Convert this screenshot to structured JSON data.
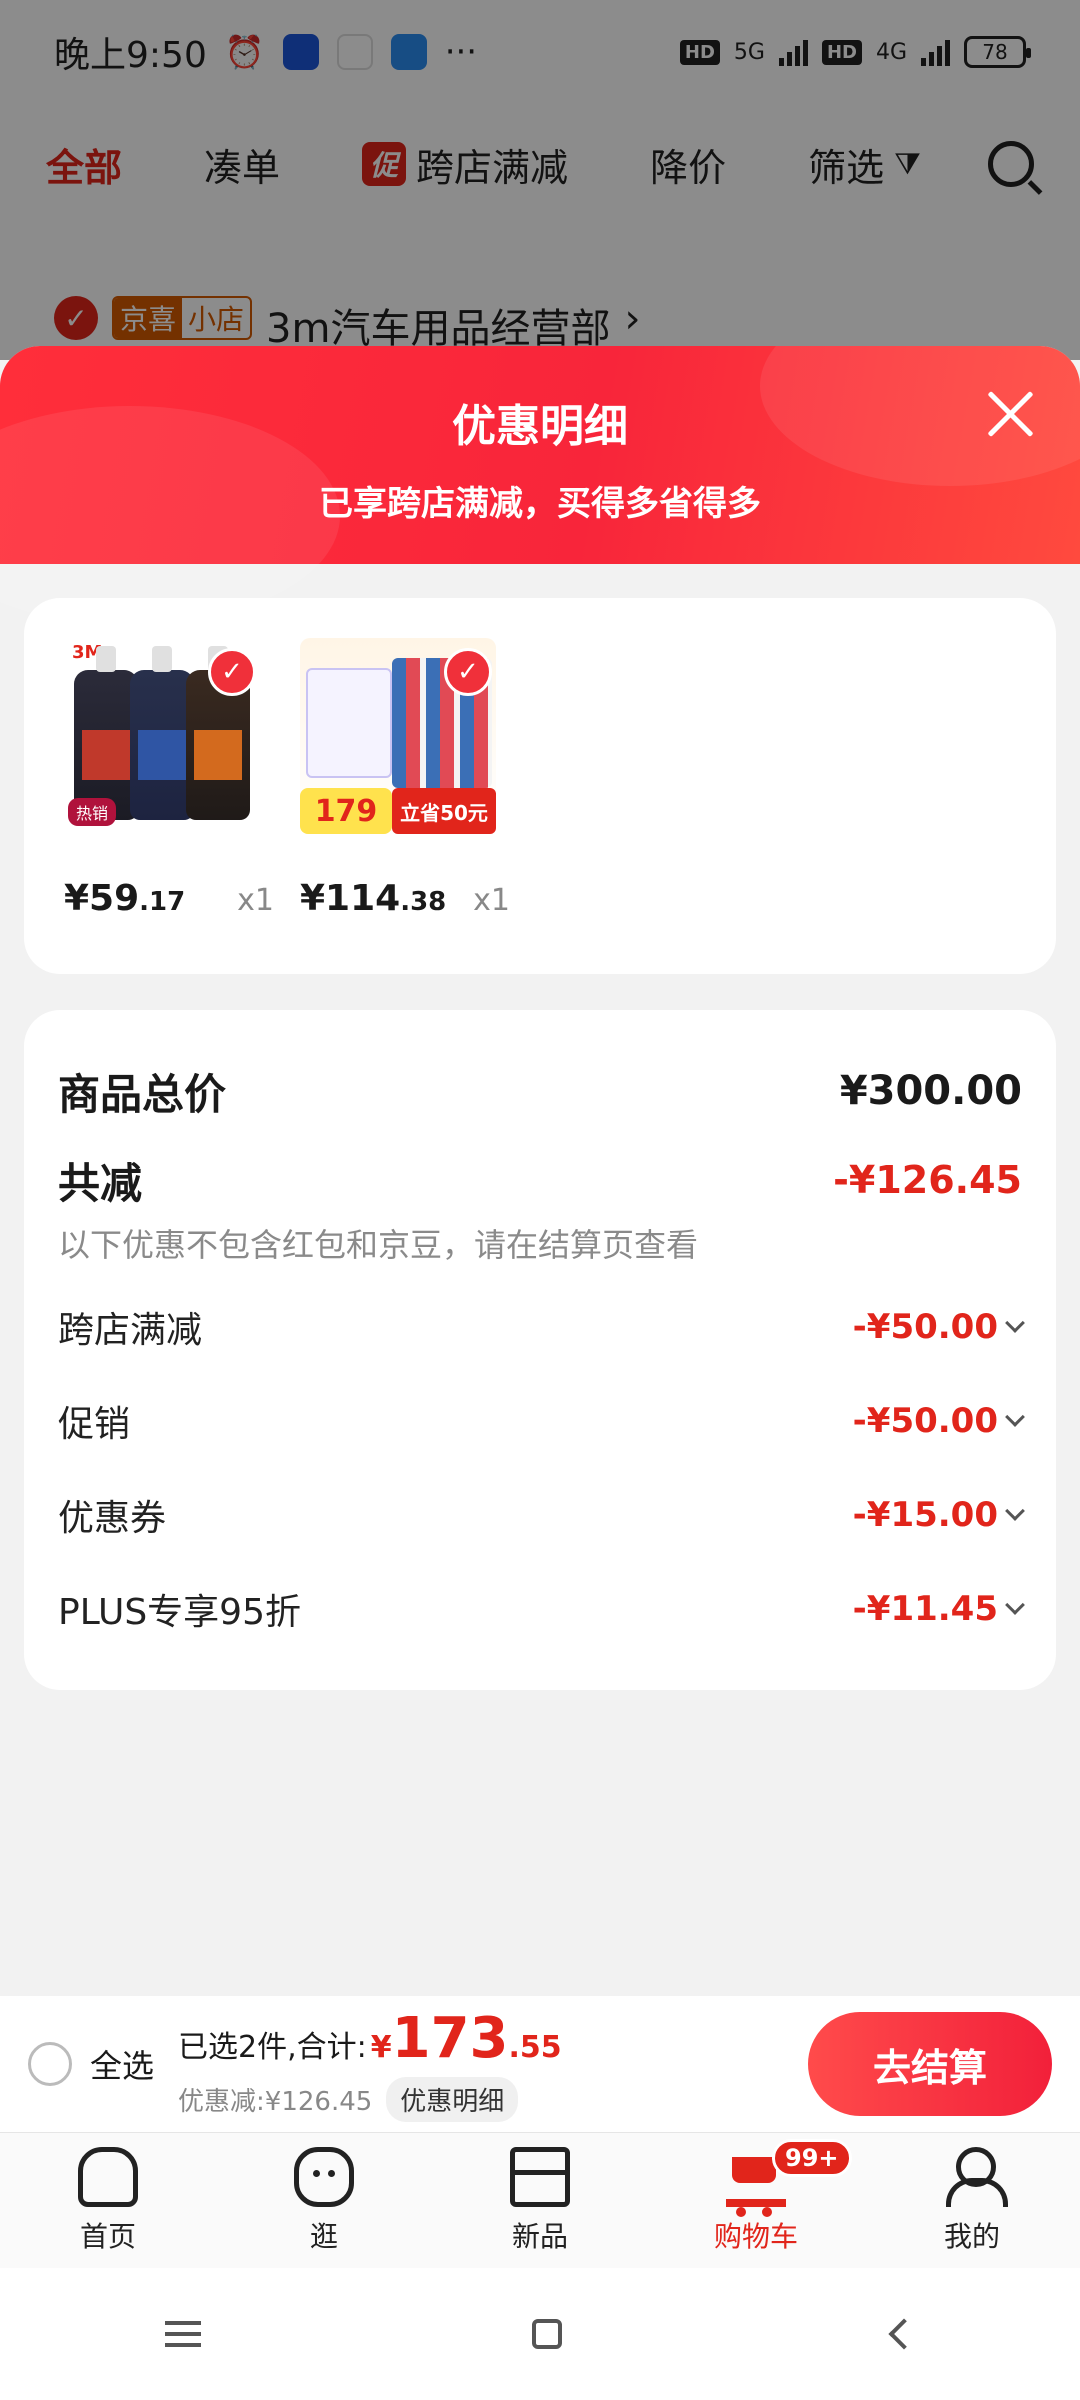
{
  "status_bar": {
    "time": "晚上9:50",
    "more": "···",
    "net1": "5G",
    "net2": "4G",
    "hd": "HD",
    "battery": "78"
  },
  "cart_tabs": {
    "all": "全部",
    "bundle": "凑单",
    "promo_badge": "促",
    "cross_store": "跨店满减",
    "price_drop": "降价",
    "filter": "筛选"
  },
  "shop": {
    "tag_left": "京喜",
    "tag_right": "小店",
    "name": "3m汽车用品经营部",
    "arrow": "›"
  },
  "sheet": {
    "title": "优惠明细",
    "subtitle": "已享跨店满减，买得多省得多"
  },
  "products": [
    {
      "price_int": "¥59",
      "price_dec": ".17",
      "qty": "x1",
      "brand": "3M",
      "badge": "热销"
    },
    {
      "price_int": "¥114",
      "price_dec": ".38",
      "qty": "x1",
      "img_price": "179",
      "img_save": "立省50元"
    }
  ],
  "summary": {
    "total_label": "商品总价",
    "total_value": "¥300.00",
    "reduce_label": "共减",
    "reduce_value": "-¥126.45",
    "note": "以下优惠不包含红包和京豆，请在结算页查看",
    "items": [
      {
        "label": "跨店满减",
        "value": "-¥50.00"
      },
      {
        "label": "促销",
        "value": "-¥50.00"
      },
      {
        "label": "优惠券",
        "value": "-¥15.00"
      },
      {
        "label": "PLUS专享95折",
        "value": "-¥11.45"
      }
    ]
  },
  "checkout": {
    "select_all": "全选",
    "selected_text": "已选2件,合计:",
    "currency": "¥",
    "amount_int": "173",
    "amount_dec": ".55",
    "discount_text": "优惠减:¥126.45",
    "detail_chip": "优惠明细",
    "button": "去结算"
  },
  "tabs": [
    {
      "label": "首页",
      "icon": "home-icon"
    },
    {
      "label": "逛",
      "icon": "browse-icon"
    },
    {
      "label": "新品",
      "icon": "box-icon"
    },
    {
      "label": "购物车",
      "icon": "cart-icon",
      "badge": "99+"
    },
    {
      "label": "我的",
      "icon": "user-icon"
    }
  ],
  "colors": {
    "accent": "#e1251b",
    "header_gradient_start": "#ff2e3a",
    "header_gradient_end": "#ff4a3e"
  }
}
